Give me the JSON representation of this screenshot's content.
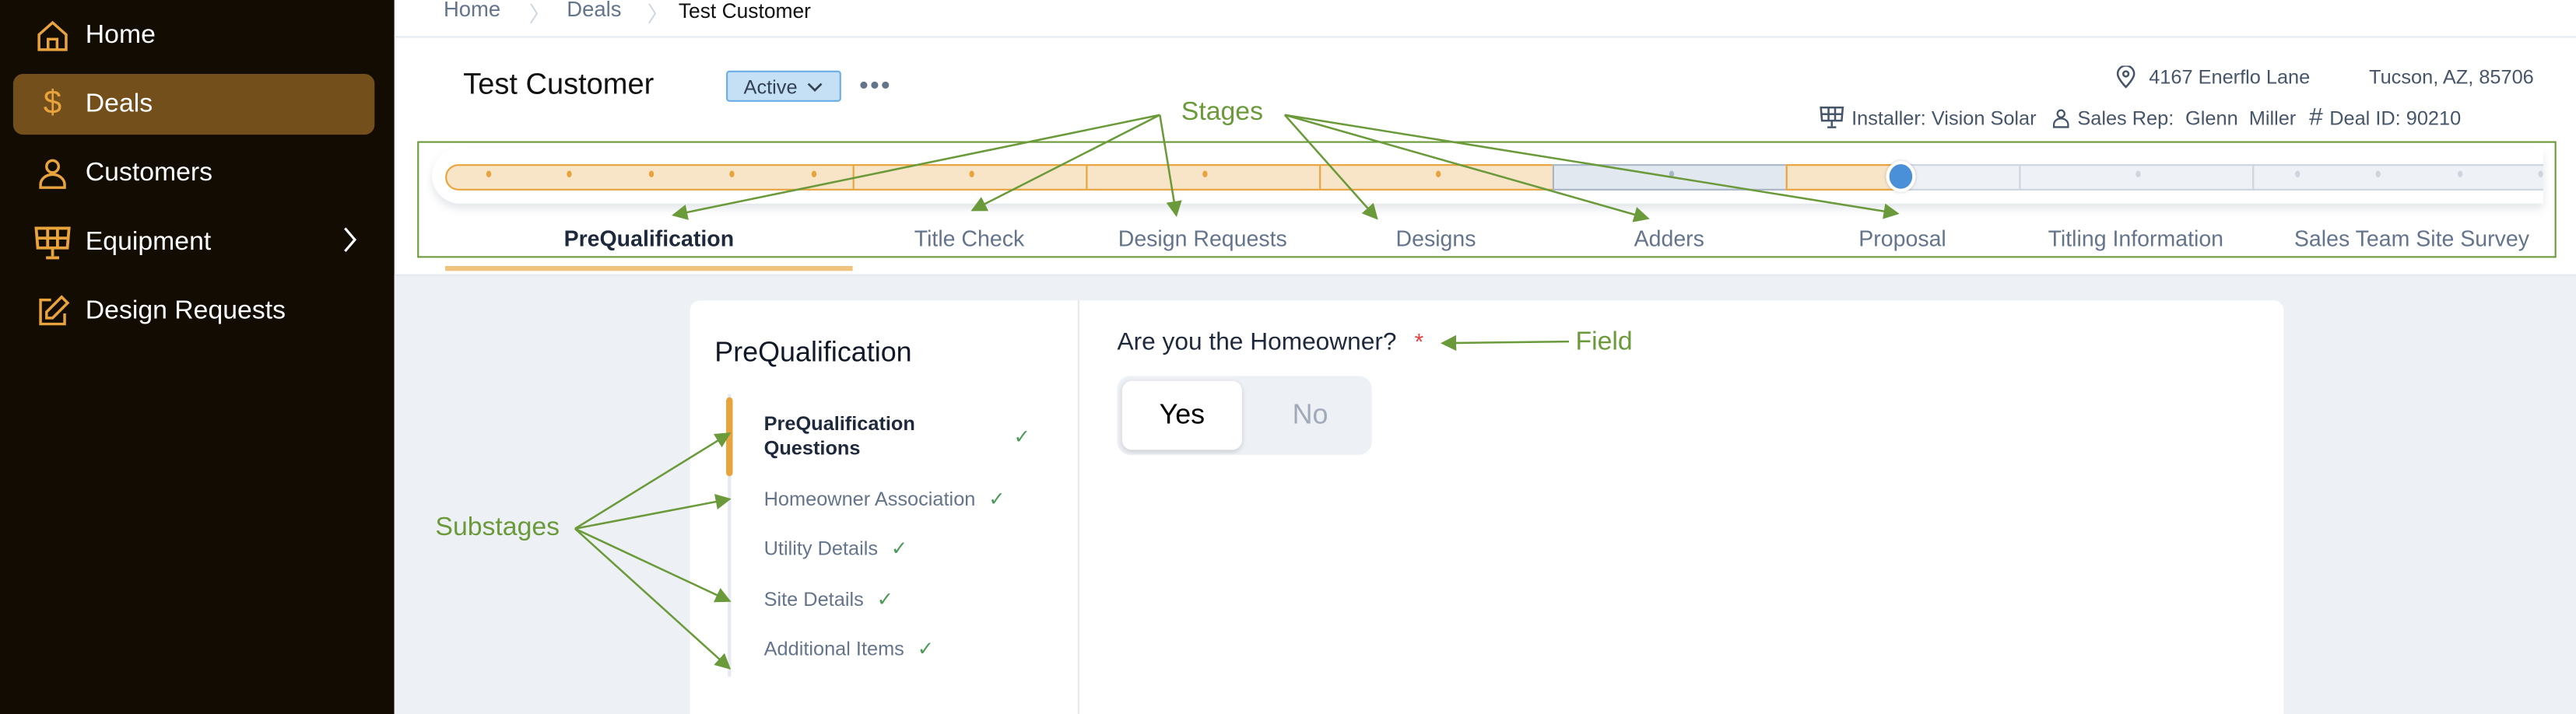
{
  "sidebar": {
    "items": [
      {
        "label": "Home",
        "icon": "home-icon"
      },
      {
        "label": "Deals",
        "icon": "dollar-icon",
        "active": true
      },
      {
        "label": "Customers",
        "icon": "user-icon"
      },
      {
        "label": "Equipment",
        "icon": "solar-panel-icon",
        "has_submenu": true
      },
      {
        "label": "Design Requests",
        "icon": "edit-icon"
      }
    ]
  },
  "breadcrumb": [
    "Home",
    "Deals",
    "Test Customer"
  ],
  "header": {
    "title": "Test Customer",
    "status": "Active",
    "address": "4167 Enerflo Lane",
    "city": "Tucson, AZ, 85706",
    "installer": "Installer: Vision Solar",
    "sales_rep_label": "Sales Rep:",
    "sales_rep": "Glenn  Miller",
    "deal_id": "Deal ID: 90210"
  },
  "stages": [
    {
      "label": "PreQualification",
      "state": "active"
    },
    {
      "label": "Title Check",
      "state": "done"
    },
    {
      "label": "Design Requests",
      "state": "done"
    },
    {
      "label": "Designs",
      "state": "done"
    },
    {
      "label": "Adders",
      "state": "skipped"
    },
    {
      "label": "Proposal",
      "state": "current",
      "progress": 0.5
    },
    {
      "label": "Titling Information",
      "state": "todo"
    },
    {
      "label": "Sales Team Site Survey",
      "state": "todo"
    }
  ],
  "substages": {
    "title": "PreQualification",
    "items": [
      {
        "label": "PreQualification Questions",
        "line1": "PreQualification",
        "line2": "Questions",
        "complete": true,
        "active": true
      },
      {
        "label": "Homeowner Association",
        "complete": true
      },
      {
        "label": "Utility Details",
        "complete": true
      },
      {
        "label": "Site Details",
        "complete": true
      },
      {
        "label": "Additional Items",
        "complete": true
      }
    ]
  },
  "field": {
    "label": "Are you the Homeowner?",
    "required_mark": "*",
    "options": [
      "Yes",
      "No"
    ],
    "selected": "Yes"
  },
  "annotations": {
    "stages": "Stages",
    "substages": "Substages",
    "field": "Field"
  },
  "colors": {
    "sidebar_bg": "#120c02",
    "active_nav": "#734f1b",
    "accent": "#e8a33d",
    "annotation": "#6a9a3a",
    "current_marker": "#4a90d9"
  }
}
